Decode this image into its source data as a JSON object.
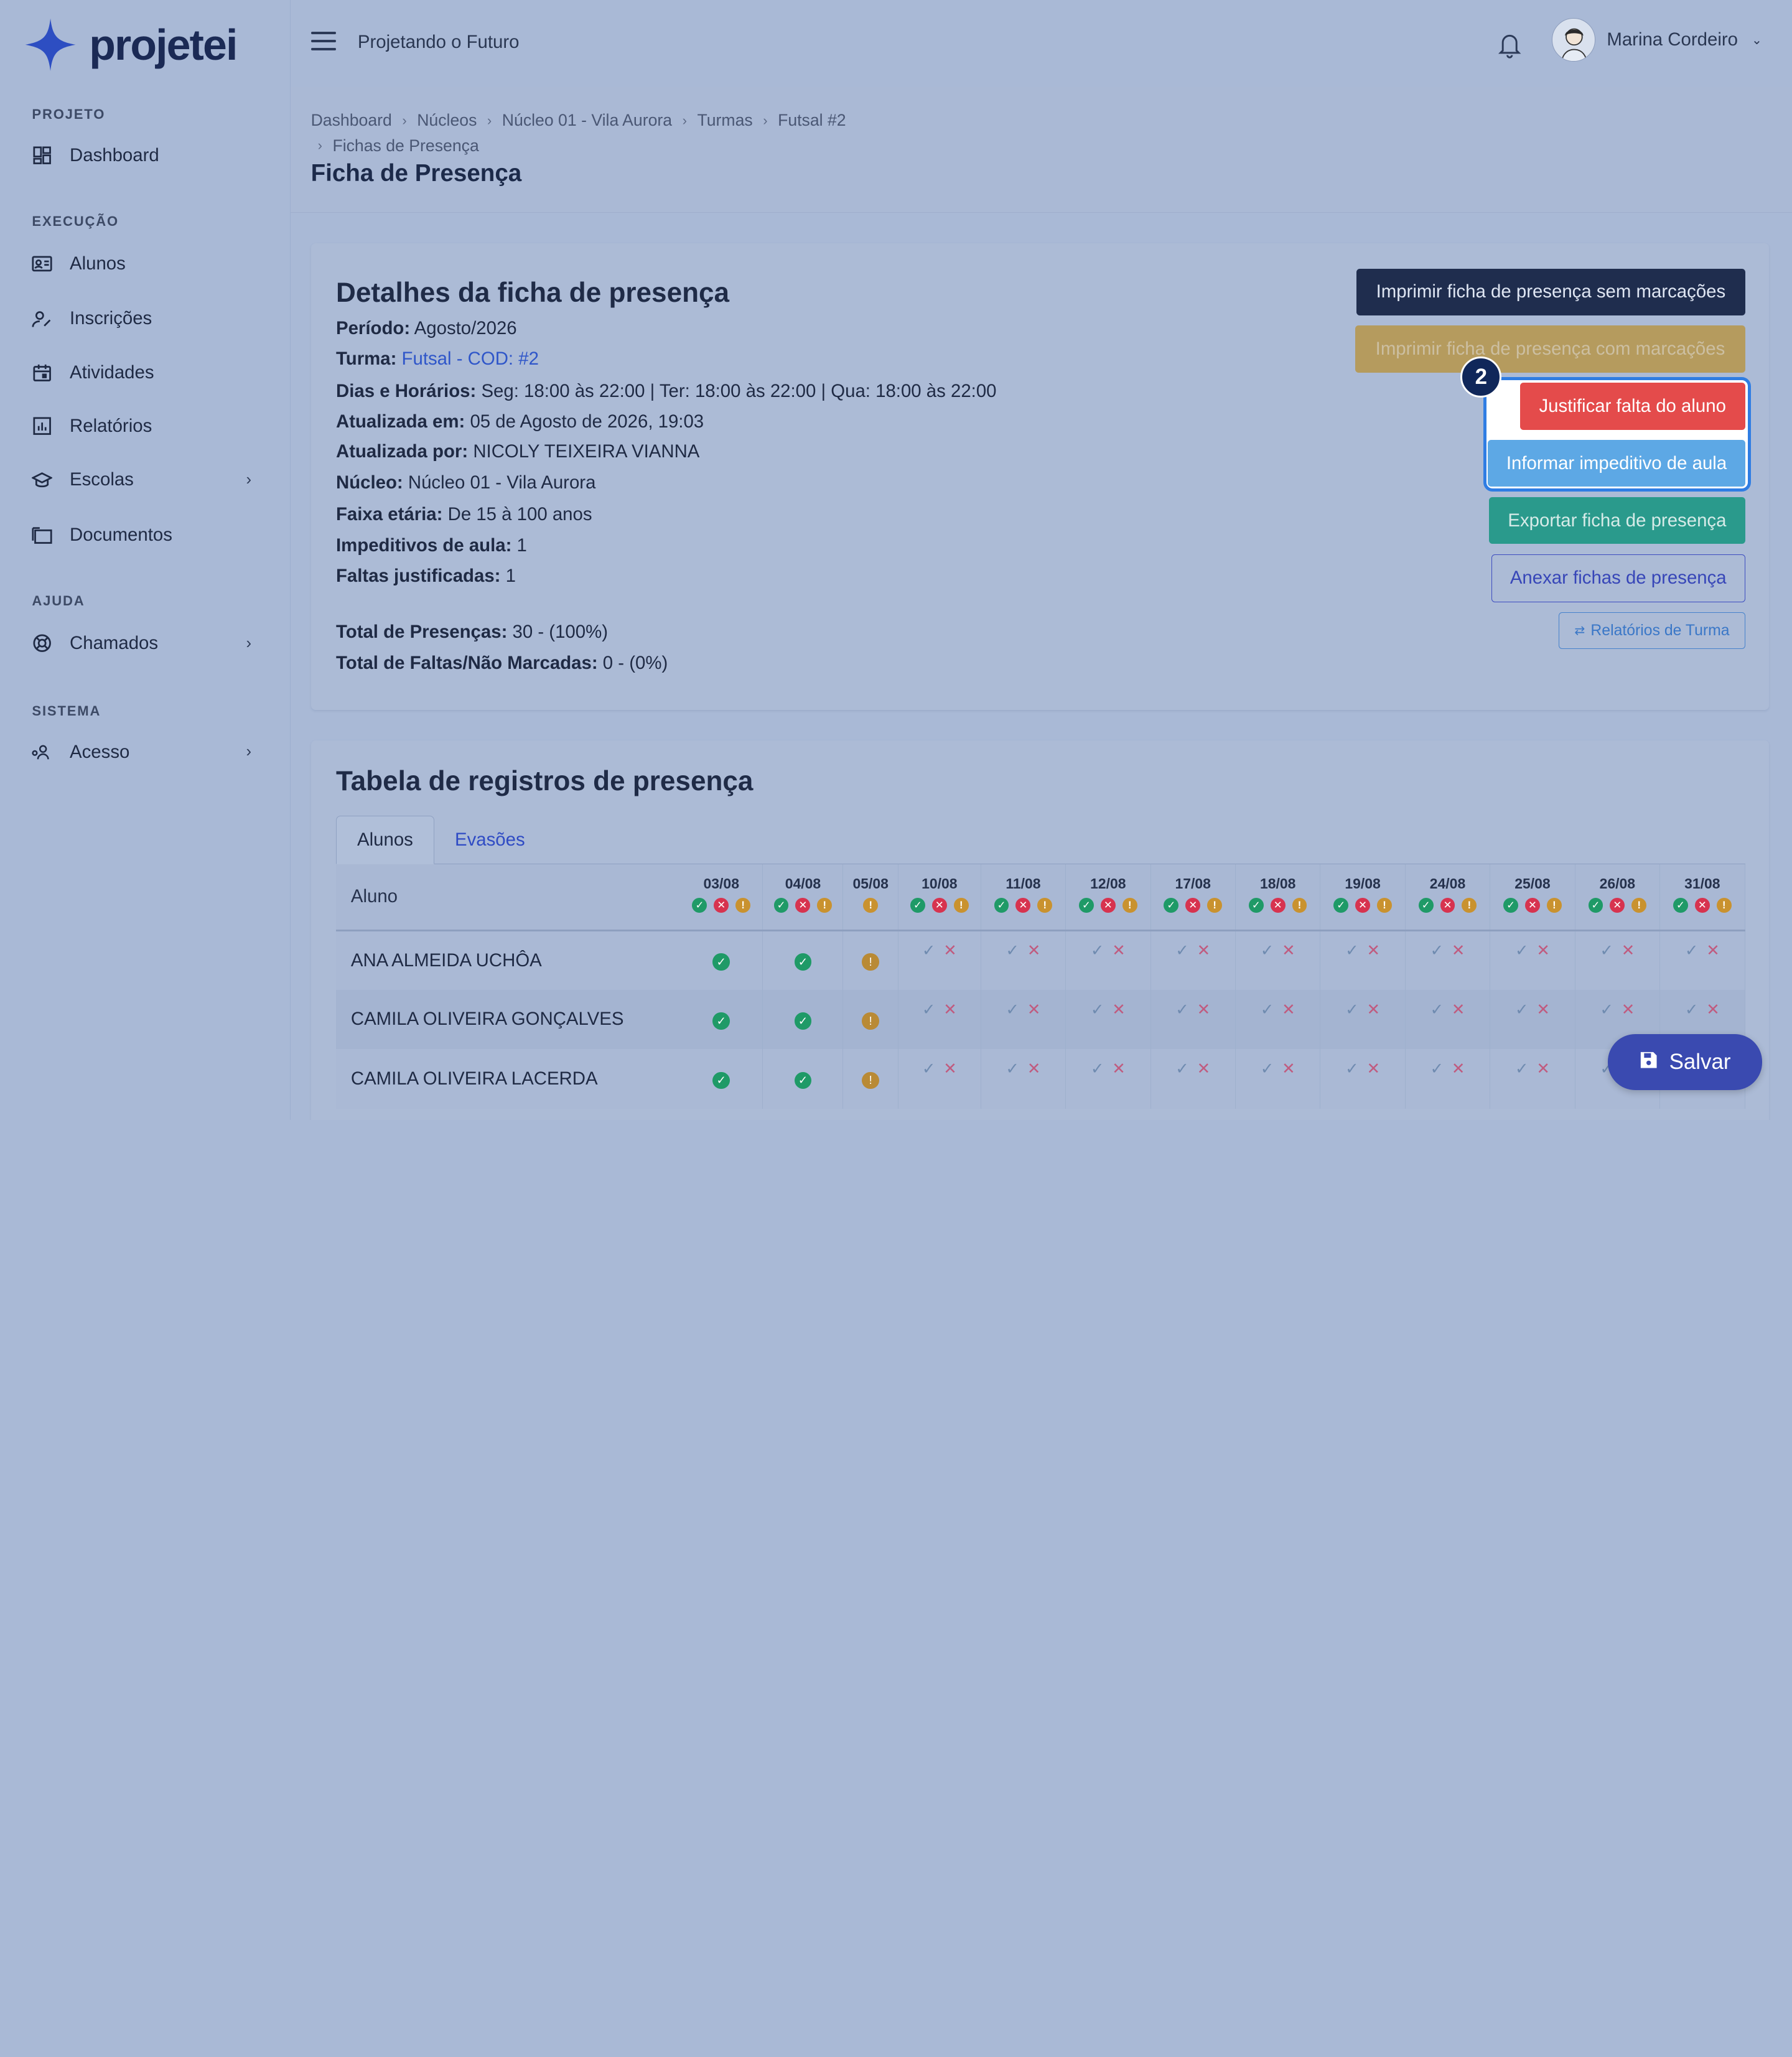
{
  "brand": {
    "name": "projetei",
    "logo_color": "#2d4ec2"
  },
  "header": {
    "org_title": "Projetando o Futuro",
    "user_name": "Marina Cordeiro"
  },
  "sidebar": {
    "sections": [
      {
        "title": "PROJETO",
        "items": [
          {
            "label": "Dashboard",
            "icon": "dashboard-icon"
          }
        ]
      },
      {
        "title": "EXECUÇÃO",
        "items": [
          {
            "label": "Alunos",
            "icon": "id-card-icon"
          },
          {
            "label": "Inscrições",
            "icon": "user-edit-icon"
          },
          {
            "label": "Atividades",
            "icon": "calendar-icon"
          },
          {
            "label": "Relatórios",
            "icon": "bar-chart-icon"
          },
          {
            "label": "Escolas",
            "icon": "school-icon"
          },
          {
            "label": "Documentos",
            "icon": "folders-icon"
          }
        ]
      },
      {
        "title": "AJUDA",
        "items": [
          {
            "label": "Chamados",
            "icon": "lifebuoy-icon"
          }
        ]
      },
      {
        "title": "SISTEMA",
        "items": [
          {
            "label": "Acesso",
            "icon": "user-key-icon"
          }
        ]
      }
    ]
  },
  "breadcrumb": [
    "Dashboard",
    "Núcleos",
    "Núcleo 01 - Vila Aurora",
    "Turmas",
    "Futsal #2",
    "Fichas de Presença"
  ],
  "page_title": "Ficha de Presença",
  "details": {
    "title": "Detalhes da ficha de presença",
    "periodo_label": "Período:",
    "periodo": "Agosto/2026",
    "turma_label": "Turma:",
    "turma": "Futsal - COD: #2",
    "dias_label": "Dias e Horários:",
    "dias": "Seg: 18:00 às 22:00 | Ter: 18:00 às 22:00 | Qua: 18:00 às 22:00",
    "atualizada_em_label": "Atualizada em:",
    "atualizada_em": "05 de Agosto de 2026, 19:03",
    "atualizada_por_label": "Atualizada por:",
    "atualizada_por": "NICOLY TEIXEIRA VIANNA",
    "nucleo_label": "Núcleo:",
    "nucleo": "Núcleo 01 - Vila Aurora",
    "faixa_label": "Faixa etária:",
    "faixa": "De 15 à 100 anos",
    "impeditivos_label": "Impeditivos de aula:",
    "impeditivos": "1",
    "faltas_just_label": "Faltas justificadas:",
    "faltas_just": "1",
    "total_pres_label": "Total de Presenças:",
    "total_pres": "30 - (100%)",
    "total_faltas_label": "Total de Faltas/Não Marcadas:",
    "total_faltas": "0 - (0%)"
  },
  "actions": {
    "print_no_marks": "Imprimir ficha de presença sem marcações",
    "print_with_marks": "Imprimir ficha de presença com marcações",
    "justify_absence": "Justificar falta do aluno",
    "inform_impediment": "Informar impeditivo de aula",
    "export": "Exportar ficha de presença",
    "attach": "Anexar fichas de presença",
    "class_reports": "Relatórios de Turma",
    "step_badge": "2"
  },
  "table": {
    "title": "Tabela de registros de presença",
    "tabs": [
      "Alunos",
      "Evasões"
    ],
    "name_header": "Aluno",
    "dates": [
      "03/08",
      "04/08",
      "05/08",
      "10/08",
      "11/08",
      "12/08",
      "17/08",
      "18/08",
      "19/08",
      "24/08",
      "25/08",
      "26/08",
      "31/08"
    ],
    "date_status_icons": [
      [
        "g",
        "r",
        "o"
      ],
      [
        "g",
        "r",
        "o"
      ],
      [
        "o"
      ],
      [
        "g",
        "r",
        "o"
      ],
      [
        "g",
        "r",
        "o"
      ],
      [
        "g",
        "r",
        "o"
      ],
      [
        "g",
        "r",
        "o"
      ],
      [
        "g",
        "r",
        "o"
      ],
      [
        "g",
        "r",
        "o"
      ],
      [
        "g",
        "r",
        "o"
      ],
      [
        "g",
        "r",
        "o"
      ],
      [
        "g",
        "r",
        "o"
      ],
      [
        "g",
        "r",
        "o"
      ]
    ],
    "rows": [
      {
        "name": "ANA ALMEIDA UCHÔA",
        "marks": [
          "present",
          "present",
          "impediment"
        ]
      },
      {
        "name": "CAMILA OLIVEIRA GONÇALVES",
        "marks": [
          "present",
          "present",
          "impediment"
        ]
      },
      {
        "name": "CAMILA OLIVEIRA LACERDA",
        "marks": [
          "present",
          "present",
          "impediment"
        ]
      }
    ]
  },
  "save_label": "Salvar"
}
